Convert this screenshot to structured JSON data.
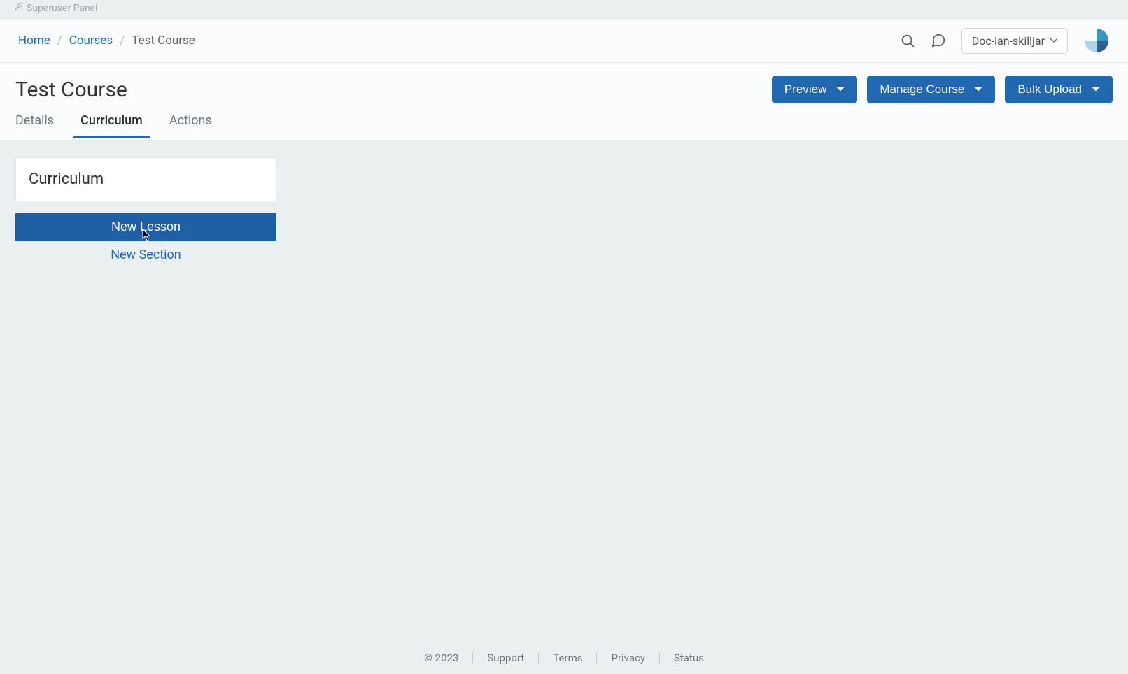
{
  "superuser": {
    "label": "Superuser Panel"
  },
  "breadcrumb": {
    "home": "Home",
    "courses": "Courses",
    "current": "Test Course"
  },
  "user": {
    "name": "Doc-ian-skilljar"
  },
  "page": {
    "title": "Test Course"
  },
  "actions": {
    "preview": "Preview",
    "manage": "Manage Course",
    "bulk": "Bulk Upload"
  },
  "tabs": {
    "details": "Details",
    "curriculum": "Curriculum",
    "actions": "Actions"
  },
  "panel": {
    "title": "Curriculum",
    "newLesson": "New Lesson",
    "newSection": "New Section"
  },
  "footer": {
    "copyright": "© 2023",
    "support": "Support",
    "terms": "Terms",
    "privacy": "Privacy",
    "status": "Status"
  }
}
